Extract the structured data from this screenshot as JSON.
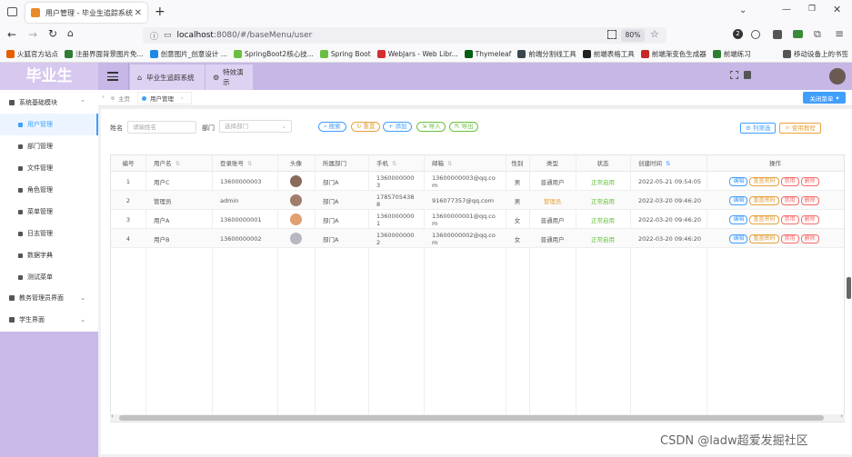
{
  "browser": {
    "tab_title": "用户管理 - 毕业生追踪系统",
    "url_host": "localhost",
    "url_rest": ":8080/#/baseMenu/user",
    "zoom": "80%",
    "bookmarks": [
      {
        "label": "火狐官方站点",
        "color": "#e66000"
      },
      {
        "label": "注册界面背景图片免...",
        "color": "#2e7d32"
      },
      {
        "label": "创意图片_创意设计 ...",
        "color": "#1e88e5"
      },
      {
        "label": "SpringBoot2核心技...",
        "color": "#6abf40"
      },
      {
        "label": "Spring Boot",
        "color": "#6abf40"
      },
      {
        "label": "WebJars - Web Libr...",
        "color": "#d32f2f"
      },
      {
        "label": "Thymeleaf",
        "color": "#005f0f"
      },
      {
        "label": "前端分割线工具",
        "color": "#37474f"
      },
      {
        "label": "前端表格工具",
        "color": "#222222"
      },
      {
        "label": "前端渐变色生成器",
        "color": "#c62828"
      },
      {
        "label": "前端练习",
        "color": "#2e7d32"
      },
      {
        "label": "移动设备上的书签",
        "color": "#555555"
      }
    ]
  },
  "app": {
    "logo": "毕业生",
    "top_tabs": [
      "毕业生追踪系统",
      "特效演示"
    ],
    "breadcrumb_home": "主页",
    "breadcrumb_current": "用户管理",
    "close_menu": "关闭菜单"
  },
  "sidebar": {
    "groups": [
      {
        "label": "系统基础模块",
        "open": true
      },
      {
        "label": "教务管理员界面",
        "open": false
      },
      {
        "label": "学生界面",
        "open": false
      }
    ],
    "items": [
      "用户管理",
      "部门管理",
      "文件管理",
      "角色管理",
      "菜单管理",
      "日志管理",
      "数据字典",
      "测试菜单"
    ]
  },
  "search": {
    "name_label": "姓名",
    "name_placeholder": "请输姓名",
    "dept_label": "部门",
    "dept_placeholder": "选择部门",
    "buttons": [
      "搜索",
      "重置",
      "添加",
      "导入",
      "导出"
    ],
    "right_buttons": [
      "列筛选",
      "使用教程"
    ]
  },
  "table": {
    "headers": [
      "编号",
      "用户名",
      "登录账号",
      "头像",
      "所属部门",
      "手机",
      "邮箱",
      "性别",
      "类型",
      "状态",
      "创建时间",
      "操作"
    ],
    "rows": [
      {
        "id": "1",
        "username": "用户C",
        "account": "13600000003",
        "dept": "部门A",
        "phone1": "1360000000",
        "phone2": "3",
        "email1": "13600000003@qq.co",
        "email2": "m",
        "gender": "男",
        "type": "普通用户",
        "type_color": "#555555",
        "status": "正常启用",
        "created": "2022-05-21 09:54:05",
        "avatar_color": "#8a6a5a"
      },
      {
        "id": "2",
        "username": "管理员",
        "account": "admin",
        "dept": "部门A",
        "phone1": "1785705438",
        "phone2": "8",
        "email1": "916077357@qq.com",
        "email2": "",
        "gender": "男",
        "type": "管理员",
        "type_color": "#e6a23c",
        "status": "正常启用",
        "created": "2022-03-20 09:46:20",
        "avatar_color": "#a07c6a"
      },
      {
        "id": "3",
        "username": "用户A",
        "account": "13600000001",
        "dept": "部门A",
        "phone1": "1360000000",
        "phone2": "1",
        "email1": "13600000001@qq.co",
        "email2": "m",
        "gender": "女",
        "type": "普通用户",
        "type_color": "#555555",
        "status": "正常启用",
        "created": "2022-03-20 09:46:20",
        "avatar_color": "#e0a070"
      },
      {
        "id": "4",
        "username": "用户B",
        "account": "13600000002",
        "dept": "部门A",
        "phone1": "1360000000",
        "phone2": "2",
        "email1": "13600000002@qq.co",
        "email2": "m",
        "gender": "女",
        "type": "普通用户",
        "type_color": "#555555",
        "status": "正常启用",
        "created": "2022-03-20 09:46:20",
        "avatar_color": "#b8b8c0"
      }
    ],
    "actions": [
      {
        "label": "编辑",
        "color": "#409eff"
      },
      {
        "label": "重置密码",
        "color": "#e6a23c"
      },
      {
        "label": "禁用",
        "color": "#f56c6c"
      },
      {
        "label": "删除",
        "color": "#f56c6c"
      }
    ]
  },
  "watermark": "CSDN @ladw超爱发掘社区",
  "colors": {
    "accent": "#409eff",
    "success": "#67c23a",
    "purple": "#c6b7e6"
  }
}
